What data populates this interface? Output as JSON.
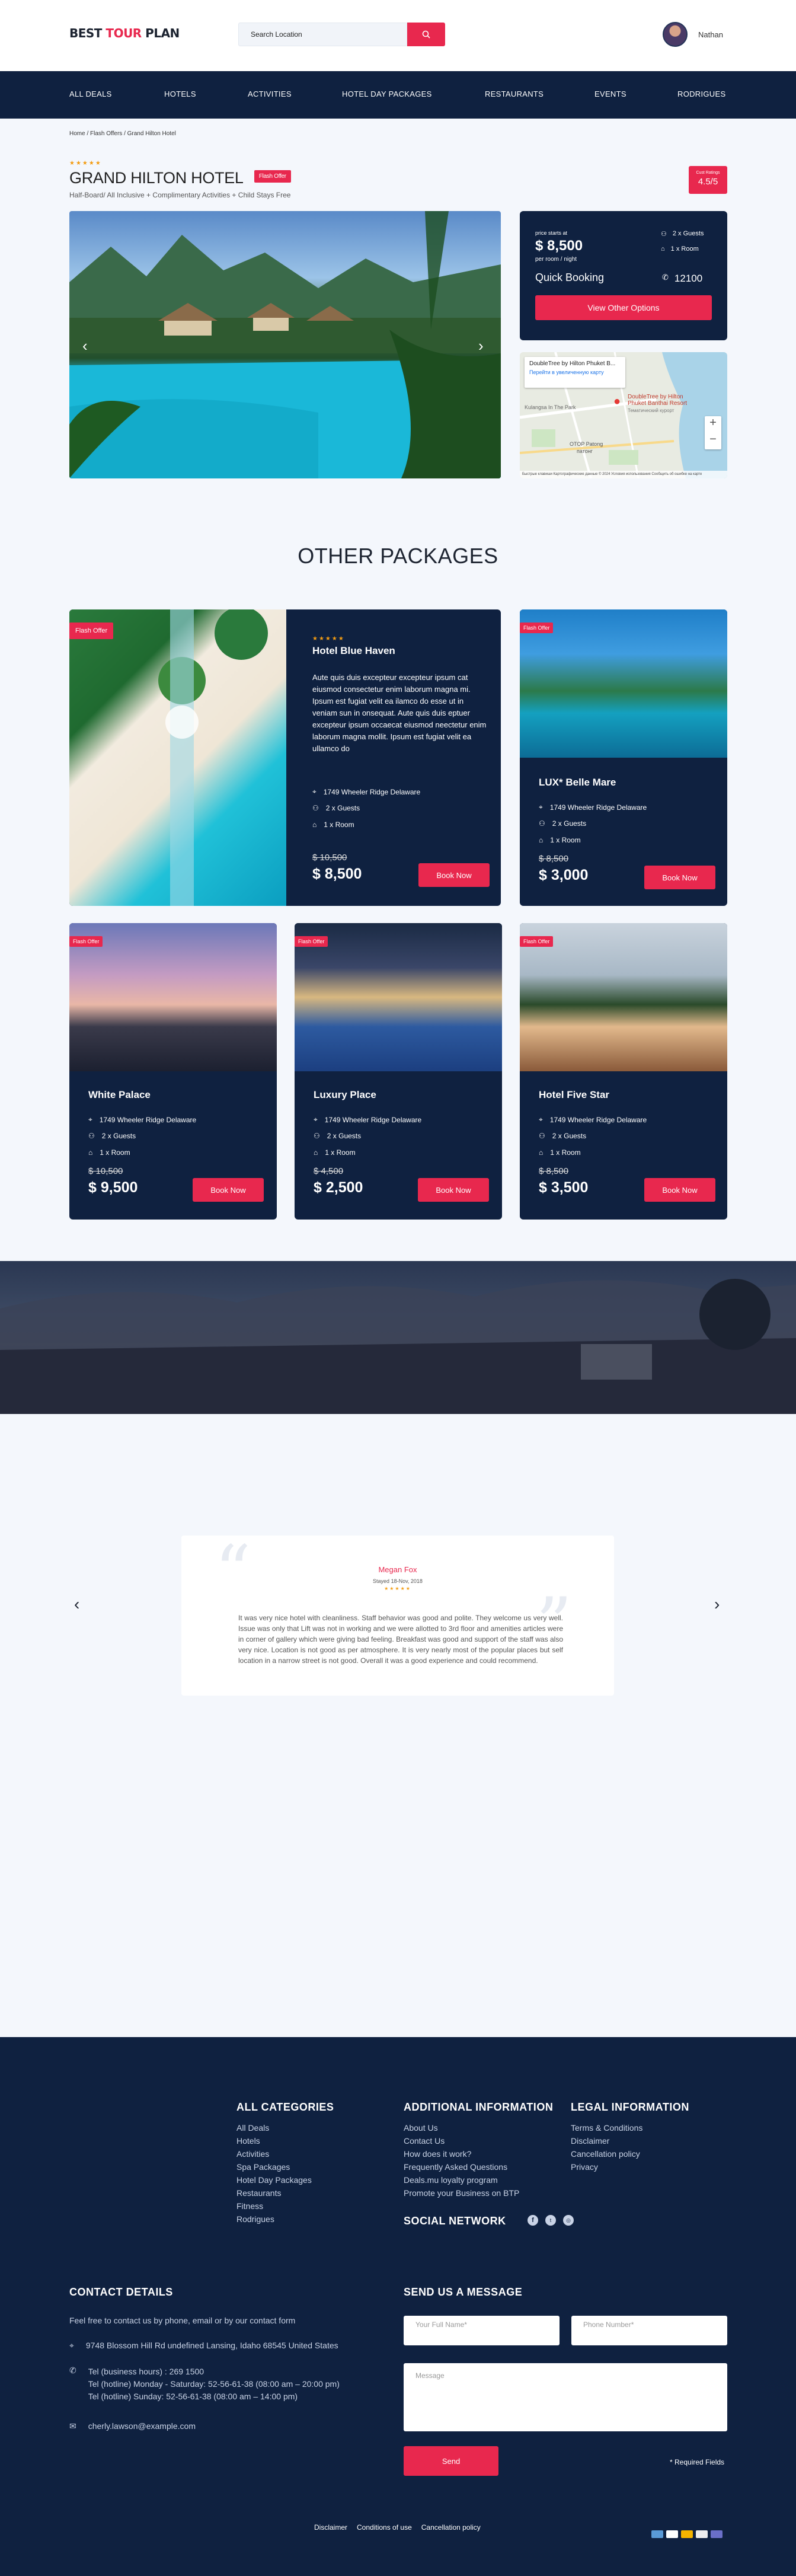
{
  "brand": {
    "part1": "BEST ",
    "part2": "TOUR ",
    "part3": "PLAN"
  },
  "search": {
    "placeholder": "Search Location"
  },
  "user": {
    "name": "Nathan"
  },
  "nav": [
    "ALL DEALS",
    "HOTELS",
    "ACTIVITIES",
    "HOTEL DAY PACKAGES",
    "RESTAURANTS",
    "EVENTS",
    "RODRIGUES"
  ],
  "breadcrumb": "Home / Flash Offers / Grand Hilton Hotel",
  "hotel": {
    "stars": "★★★★★",
    "title": "GRAND HILTON HOTEL",
    "flash": "Flash Offer",
    "subtitle": "Half-Board/ All Inclusive + Complimentary Activities + Child Stays Free",
    "rating_label": "Cust Ratings",
    "rating_value": "4.5/5"
  },
  "booking": {
    "price_label": "price starts at",
    "price": "$ 8,500",
    "per": "per room / night",
    "guests": "2 x Guests",
    "rooms": "1 x Room",
    "quick": "Quick Booking",
    "phone": "12100",
    "button": "View Other Options"
  },
  "map": {
    "place": "DoubleTree by Hilton Phuket B...",
    "link": "Перейти в увеличенную карту",
    "pin": "DoubleTree by Hilton Phuket Banthai Resort",
    "pin_sub": "Тематический курорт",
    "label1": "Kulangsa In The Park",
    "label2": "OTOP Patong",
    "label3": "патонг",
    "footer": "Быстрые клавиши   Картографические данные © 2024   Условия использования   Сообщить об ошибке на карте",
    "zoom_in": "+",
    "zoom_out": "−"
  },
  "section": {
    "title": "OTHER PACKAGES"
  },
  "packages": [
    {
      "flash": "Flash Offer",
      "stars": "★★★★★",
      "name": "Hotel Blue Haven",
      "desc": "Aute quis duis excepteur excepteur ipsum cat eiusmod consectetur enim laborum magna mi. Ipsum est fugiat velit ea ilamco do esse ut in veniam sun in onsequat. Aute quis duis eptuer excepteur ipsum occaecat eiusmod neectetur enim laborum magna mollit. Ipsum est fugiat velit ea ullamco do",
      "address": "1749 Wheeler Ridge Delaware",
      "guests": "2 x Guests",
      "rooms": "1 x Room",
      "old": "$ 10,500",
      "price": "$ 8,500",
      "button": "Book Now"
    },
    {
      "flash": "Flash Offer",
      "name": "LUX* Belle Mare",
      "address": "1749 Wheeler Ridge Delaware",
      "guests": "2 x Guests",
      "rooms": "1 x Room",
      "old": "$ 8,500",
      "price": "$ 3,000",
      "button": "Book Now"
    },
    {
      "flash": "Flash Offer",
      "name": "White Palace",
      "address": "1749 Wheeler Ridge Delaware",
      "guests": "2 x Guests",
      "rooms": "1 x Room",
      "old": "$ 10,500",
      "price": "$ 9,500",
      "button": "Book Now"
    },
    {
      "flash": "Flash Offer",
      "name": "Luxury Place",
      "address": "1749 Wheeler Ridge Delaware",
      "guests": "2 x Guests",
      "rooms": "1 x Room",
      "old": "$ 4,500",
      "price": "$ 2,500",
      "button": "Book Now"
    },
    {
      "flash": "Flash Offer",
      "name": "Hotel Five Star",
      "address": "1749 Wheeler Ridge Delaware",
      "guests": "2 x Guests",
      "rooms": "1 x Room",
      "old": "$ 8,500",
      "price": "$ 3,500",
      "button": "Book Now"
    }
  ],
  "review": {
    "name": "Megan Fox",
    "date": "Stayed 18-Nov, 2018",
    "stars": "★★★★★",
    "text": "It was very nice hotel with cleanliness. Staff behavior was good and polite. They welcome us very well. Issue was only that Lift was not in working and we were allotted to 3rd floor and amenities articles were in corner of gallery which were giving bad feeling. Breakfast was good and support of the staff was also very nice. Location is not good as per atmosphere. It is very nearly most of the popular places but self location in a narrow street is not good. Overall it was a good experience and could recommend.",
    "prev": "‹",
    "next": "›"
  },
  "footer": {
    "cat_title": "ALL CATEGORIES",
    "categories": [
      "All Deals",
      "Hotels",
      "Activities",
      "Spa Packages",
      "Hotel Day Packages",
      "Restaurants",
      "Fitness",
      "Rodrigues"
    ],
    "info_title": "ADDITIONAL INFORMATION",
    "info": [
      "About Us",
      "Contact Us",
      "How does it work?",
      "Frequently Asked Questions",
      "Deals.mu loyalty program",
      "Promote your Business on BTP"
    ],
    "legal_title": "LEGAL INFORMATION",
    "legal": [
      "Terms & Conditions",
      "Disclaimer",
      "Cancellation policy",
      "Privacy"
    ],
    "social_title": "SOCIAL NETWORK",
    "contact_title": "CONTACT DETAILS",
    "contact_intro": "Feel free to contact us by phone, email or by our contact form",
    "address": "9748 Blossom Hill Rd undefined Lansing, Idaho 68545 United States",
    "phone1": "Tel (business hours) : 269 1500",
    "phone2": "Tel (hotline) Monday - Saturday: 52-56-61-38 (08:00 am – 20:00 pm)",
    "phone3": "Tel (hotline) Sunday: 52-56-61-38 (08:00 am – 14:00 pm)",
    "email": "cherly.lawson@example.com",
    "msg_title": "SEND US A MESSAGE",
    "name_ph": "Your Full Name*",
    "phone_ph": "Phone Number*",
    "msg_ph": "Message",
    "send": "Send",
    "required": "* Required Fields",
    "bottom": [
      "Disclaimer",
      "Conditions of use",
      "Cancellation policy"
    ]
  },
  "colors": {
    "accent": "#e8284e",
    "navy": "#0f2140",
    "gold": "#f39c12"
  }
}
